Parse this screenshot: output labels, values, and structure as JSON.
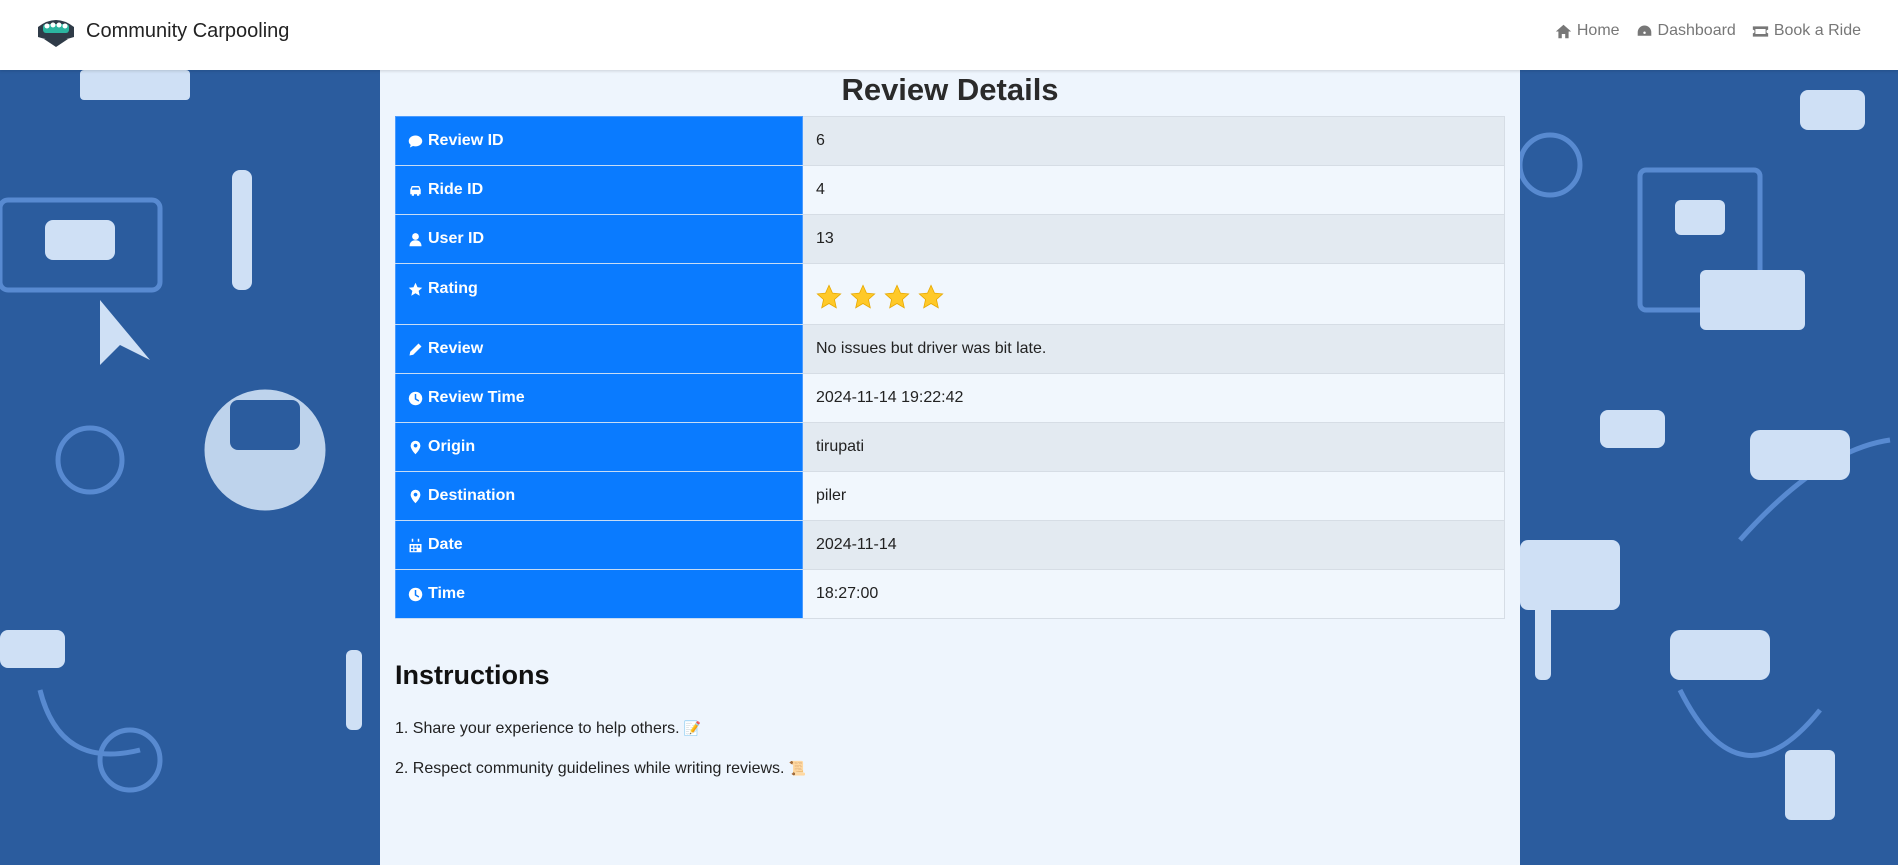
{
  "navbar": {
    "brand": "Community Carpooling",
    "links": [
      {
        "label": "Home",
        "icon": "home-icon"
      },
      {
        "label": "Dashboard",
        "icon": "dashboard-icon"
      },
      {
        "label": "Book a Ride",
        "icon": "ticket-icon"
      }
    ]
  },
  "review": {
    "title": "Review Details",
    "rows": [
      {
        "label": "Review ID",
        "value": "6",
        "icon": "comment-icon"
      },
      {
        "label": "Ride ID",
        "value": "4",
        "icon": "car-icon"
      },
      {
        "label": "User ID",
        "value": "13",
        "icon": "user-icon"
      },
      {
        "label": "Rating",
        "value": 4,
        "icon": "star-icon"
      },
      {
        "label": "Review",
        "value": "No issues but driver was bit late.",
        "icon": "pencil-icon"
      },
      {
        "label": "Review Time",
        "value": "2024-11-14 19:22:42",
        "icon": "clock-icon"
      },
      {
        "label": "Origin",
        "value": "tirupati",
        "icon": "map-marker-icon"
      },
      {
        "label": "Destination",
        "value": "piler",
        "icon": "map-marker-icon"
      },
      {
        "label": "Date",
        "value": "2024-11-14",
        "icon": "calendar-icon"
      },
      {
        "label": "Time",
        "value": "18:27:00",
        "icon": "clock-icon"
      }
    ]
  },
  "instructions": {
    "title": "Instructions",
    "items": [
      {
        "text": "1. Share your experience to help others.",
        "emoji": "📝"
      },
      {
        "text": "2. Respect community guidelines while writing reviews.",
        "emoji": "📜"
      }
    ]
  },
  "colors": {
    "accent": "#0a7bff",
    "background": "#2b5c9e",
    "panel": "#eef5fd",
    "star": "#ffc928"
  }
}
